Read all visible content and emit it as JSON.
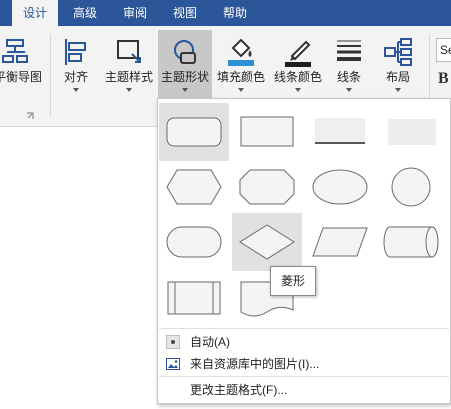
{
  "tabs": [
    {
      "label": "设计",
      "active": true
    },
    {
      "label": "高级",
      "active": false
    },
    {
      "label": "审阅",
      "active": false
    },
    {
      "label": "视图",
      "active": false
    },
    {
      "label": "帮助",
      "active": false
    }
  ],
  "ribbon": {
    "balance_map": "平衡导图",
    "align": "对齐",
    "topic_style": "主题样式",
    "topic_shape": "主题形状",
    "fill_color": "填充颜色",
    "line_color": "线条颜色",
    "line": "线条",
    "layout": "布局",
    "font_box_stub": "Se",
    "bold_stub": "B"
  },
  "colors": {
    "tab_bar": "#2b579a",
    "ribbon_bg": "#f3f3f3",
    "pressed": "#c8c8c8",
    "fill_bucket": "#2e8fd6",
    "pen_bar": "#1e1e1e"
  },
  "gallery": {
    "shapes": [
      "rounded-rectangle",
      "rectangle",
      "underline-rectangle",
      "flat-rectangle",
      "hexagon",
      "octagon",
      "ellipse",
      "circle",
      "capsule",
      "diamond",
      "parallelogram",
      "cylinder",
      "predefined-process",
      "document"
    ],
    "tooltip": "菱形"
  },
  "menu": {
    "auto": "自动(A)",
    "from_library": "来自资源库中的图片(I)...",
    "change_theme": "更改主题格式(F)..."
  }
}
